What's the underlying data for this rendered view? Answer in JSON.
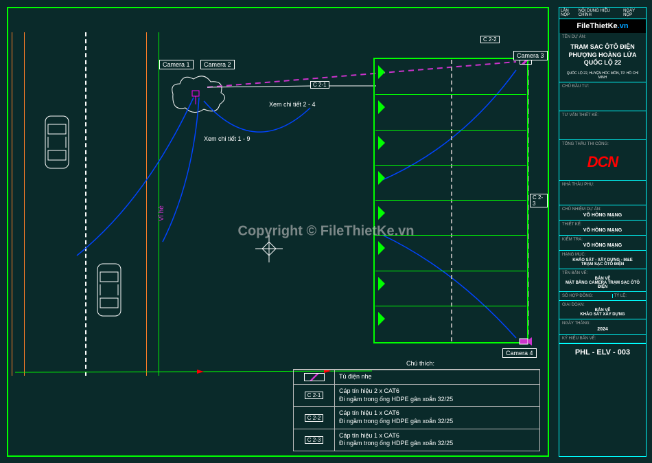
{
  "watermark": "Copyright © FileThietKe.vn",
  "brand": {
    "name": "FileThietKe",
    "suffix": ".vn"
  },
  "titleblock": {
    "header": {
      "c1": "LẦN NỘP",
      "c2": "NỘI DUNG HIỆU CHỈNH",
      "c3": "NGÀY NỘP"
    },
    "project_label": "TÊN DỰ ÁN:",
    "project_title_1": "TRẠM SẠC ÔTÔ ĐIỆN",
    "project_title_2": "PHƯỢNG HOÀNG LỬA",
    "project_title_3": "QUỐC LỘ 22",
    "project_sub": "QUỐC LỘ 22, HUYỆN HÓC MÔN, TP. HỒ CHÍ MINH",
    "owner_label": "CHỦ ĐẦU TƯ:",
    "consultant_label": "TƯ VẤN THIẾT KẾ:",
    "contractor_label": "TỔNG THẦU THI CÔNG:",
    "contractor_logo": "DCN",
    "subcontractor_label": "NHÀ THẦU PHỤ:",
    "pm_label": "CHỦ NHIỆM DỰ ÁN:",
    "pm_value": "VÕ HỒNG MẠNG",
    "designer_label": "THIẾT KẾ:",
    "designer_value": "VÕ HỒNG MẠNG",
    "checker_label": "KIỂM TRA:",
    "checker_value": "VÕ HỒNG MẠNG",
    "category_label": "HẠNG MỤC:",
    "category_value": "KHẢO SÁT - XÂY DỰNG - M&E\nTRẠM SẠC ÔTÔ ĐIỆN",
    "dwg_name_label": "TÊN BẢN VẼ:",
    "dwg_name_value": "BẢN VẼ\nMẶT BẰNG CAMERA TRẠM SẠC ÔTÔ ĐIỆN",
    "contract_label": "SỐ HỢP ĐỒNG:",
    "scale_label": "TỶ LỆ:",
    "phase_label": "GIAI ĐOẠN:",
    "phase_value": "BẢN VẼ\nKHẢO SÁT XÂY DỰNG",
    "date_label": "NGÀY THÁNG:",
    "date_value": "2024",
    "dwg_code_label": "KÝ HIỆU BẢN VẼ:",
    "dwg_code": "PHL - ELV - 003"
  },
  "labels": {
    "camera1": "Camera 1",
    "camera2": "Camera 2",
    "camera3": "Camera 3",
    "camera4": "Camera 4",
    "sidewalk": "Vỉ hè",
    "detail_2_4": "Xem chi tiết 2 - 4",
    "detail_1_9": "Xem chi tiết 1 - 9",
    "c21": "C 2-1",
    "c22": "C 2-2",
    "c23": "C 2-3"
  },
  "legend": {
    "title": "Chú thích:",
    "rows": [
      {
        "symbol_type": "panel",
        "text": "Tủ điện nhẹ"
      },
      {
        "symbol_type": "tag",
        "symbol": "C 2-1",
        "text": "Cáp tín hiệu 2 x CAT6\nĐi ngầm trong ống HDPE gân xoắn 32/25"
      },
      {
        "symbol_type": "tag",
        "symbol": "C 2-2",
        "text": "Cáp tín hiệu 1 x CAT6\nĐi ngầm trong ống HDPE gân xoắn 32/25"
      },
      {
        "symbol_type": "tag",
        "symbol": "C 2-3",
        "text": "Cáp tín hiệu 1 x CAT6\nĐi ngầm trong ống HDPE gân xoắn 32/25"
      }
    ]
  },
  "chart_data": {
    "type": "cad_plan",
    "description": "Camera layout plan for EV charging station on National Road 22",
    "cameras": [
      {
        "id": 1,
        "location": "pole_on_sidewalk",
        "facing": "south"
      },
      {
        "id": 2,
        "location": "pole_on_sidewalk",
        "facing": "east_to_parking"
      },
      {
        "id": 3,
        "location": "parking_ne_corner",
        "facing": "southwest"
      },
      {
        "id": 4,
        "location": "parking_se_corner",
        "facing": "northwest"
      }
    ],
    "cables": [
      {
        "tag": "C 2-1",
        "from": "pole",
        "to": "panel",
        "spec": "2x CAT6 in HDPE 32/25"
      },
      {
        "tag": "C 2-2",
        "from": "panel",
        "to": "camera3",
        "spec": "1x CAT6 in HDPE 32/25"
      },
      {
        "tag": "C 2-3",
        "from": "camera3",
        "to": "camera4",
        "spec": "1x CAT6 in HDPE 32/25"
      }
    ],
    "parking_slots": 8
  }
}
